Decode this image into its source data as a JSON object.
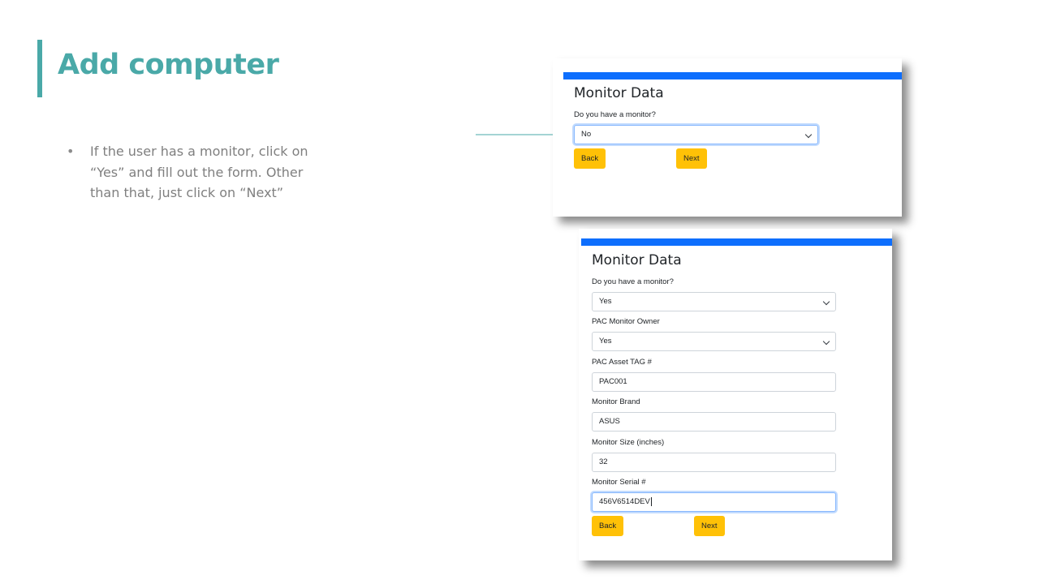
{
  "slide": {
    "title": "Add computer",
    "bullets": [
      "If the user has a monitor, click on “Yes” and fill out the form. Other than that, just click on “Next”"
    ]
  },
  "shot_no": {
    "title": "Monitor Data",
    "question_label": "Do you have a monitor?",
    "question_value": "No",
    "back_label": "Back",
    "next_label": "Next"
  },
  "shot_yes": {
    "title": "Monitor Data",
    "fields": [
      {
        "label": "Do you have a monitor?",
        "value": "Yes",
        "type": "select"
      },
      {
        "label": "PAC Monitor Owner",
        "value": "Yes",
        "type": "select"
      },
      {
        "label": "PAC Asset TAG #",
        "value": "PAC001",
        "type": "input"
      },
      {
        "label": "Monitor Brand",
        "value": "ASUS",
        "type": "input"
      },
      {
        "label": "Monitor Size (inches)",
        "value": "32",
        "type": "input"
      },
      {
        "label": "Monitor Serial #",
        "value": "456V6514DEV",
        "type": "input"
      }
    ],
    "back_label": "Back",
    "next_label": "Next"
  },
  "colors": {
    "accent": "#4aa9a8",
    "progress_bar": "#0d6efd",
    "button": "#ffc107",
    "bullet_text": "#7f7f7f"
  },
  "icons": [
    "chevron-down-icon",
    "arrow-right-icon"
  ]
}
